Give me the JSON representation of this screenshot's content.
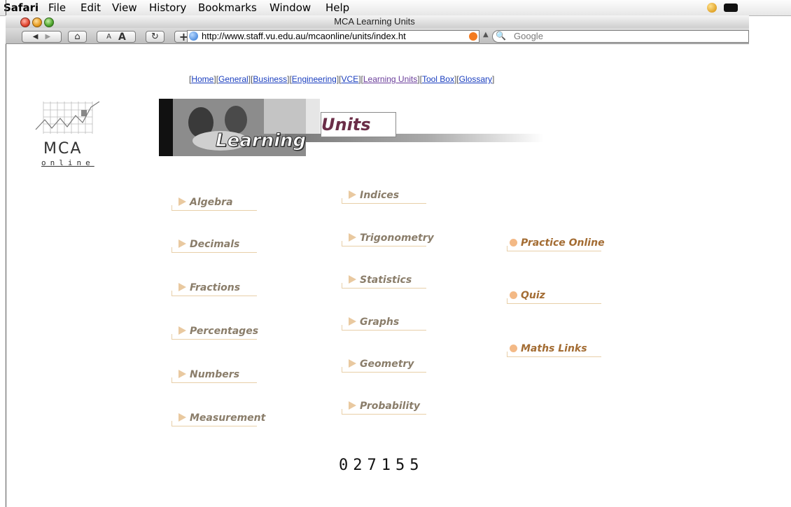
{
  "menubar": {
    "app": "Safari",
    "items": [
      "File",
      "Edit",
      "View",
      "History",
      "Bookmarks",
      "Window",
      "Help"
    ]
  },
  "window": {
    "title": "MCA Learning Units"
  },
  "toolbar": {
    "url": "http://www.staff.vu.edu.au/mcaonline/units/index.ht",
    "search_placeholder": "Google",
    "text_smaller": "A",
    "text_bigger": "A",
    "add_label": "+"
  },
  "nav": {
    "links": [
      "Home",
      "General",
      "Business",
      "Engineering",
      "VCE",
      "Learning Units",
      "Tool Box",
      "Glossary"
    ],
    "visited": "Learning Units"
  },
  "logo": {
    "title": "MCA",
    "subtitle": "online"
  },
  "banner": {
    "word1": "Learning",
    "word2": "Units"
  },
  "units": {
    "col1": [
      "Algebra",
      "Decimals",
      "Fractions",
      "Percentages",
      "Numbers",
      "Measurement"
    ],
    "col2": [
      "Indices",
      "Trigonometry",
      "Statistics",
      "Graphs",
      "Geometry",
      "Probability"
    ],
    "col3": [
      "Practice Online",
      "Quiz",
      "Maths Links"
    ]
  },
  "counter": "027155",
  "colors": {
    "link": "#1a3ebf",
    "visited": "#6a3d9a",
    "unit_text": "#8a7d6a",
    "accent": "#f3b986"
  }
}
